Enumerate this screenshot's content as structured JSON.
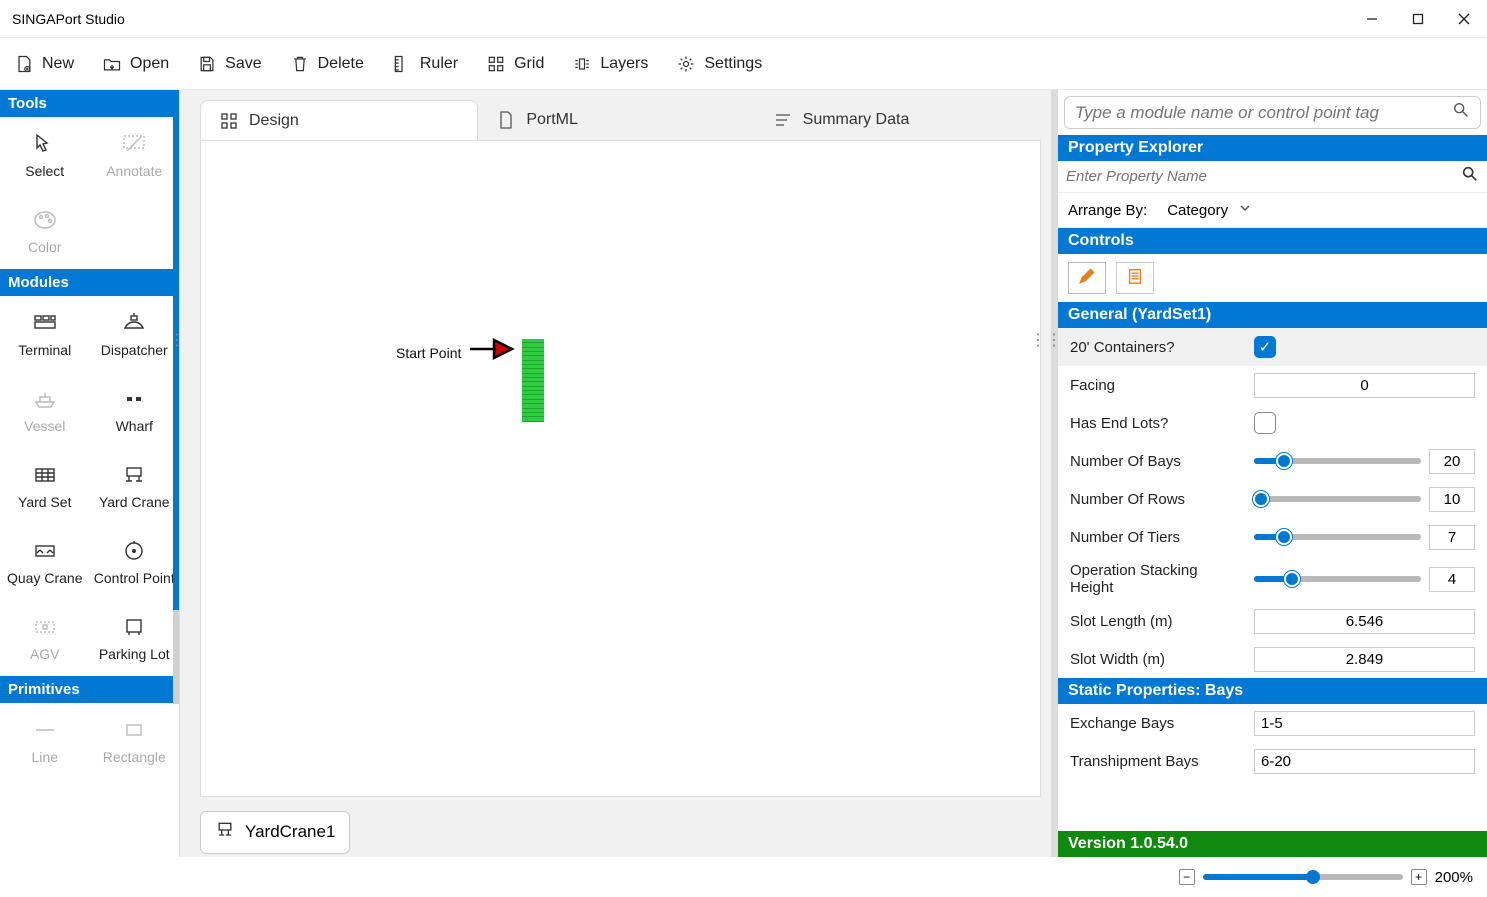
{
  "app": {
    "title": "SINGAPort Studio"
  },
  "toolbar": {
    "new": "New",
    "open": "Open",
    "save": "Save",
    "delete": "Delete",
    "ruler": "Ruler",
    "grid": "Grid",
    "layers": "Layers",
    "settings": "Settings"
  },
  "left": {
    "sections": {
      "tools": "Tools",
      "modules": "Modules",
      "primitives": "Primitives"
    },
    "tools": {
      "select": "Select",
      "annotate": "Annotate",
      "color": "Color"
    },
    "modules": {
      "terminal": "Terminal",
      "dispatcher": "Dispatcher",
      "vessel": "Vessel",
      "wharf": "Wharf",
      "yardset": "Yard Set",
      "yardcrane": "Yard Crane",
      "quaycrane": "Quay Crane",
      "controlpoint": "Control Point",
      "agv": "AGV",
      "parkinglot": "Parking Lot"
    },
    "primitives": {
      "line": "Line",
      "rectangle": "Rectangle"
    }
  },
  "tabs": {
    "design": "Design",
    "portml": "PortML",
    "summary": "Summary Data"
  },
  "canvas": {
    "start_point_label": "Start Point",
    "selected_item": "YardCrane1"
  },
  "right": {
    "search_placeholder": "Type a module name or control point tag",
    "property_explorer": "Property Explorer",
    "prop_search_placeholder": "Enter Property Name",
    "arrange_by_label": "Arrange By:",
    "arrange_by_value": "Category",
    "controls_header": "Controls",
    "general_header": "General (YardSet1)",
    "static_header": "Static Properties: Bays",
    "props": {
      "twenty_ft": {
        "label": "20' Containers?",
        "checked": true
      },
      "facing": {
        "label": "Facing",
        "value": "0"
      },
      "has_end_lots": {
        "label": "Has End Lots?",
        "checked": false
      },
      "num_bays": {
        "label": "Number Of Bays",
        "value": "20",
        "pct": 18
      },
      "num_rows": {
        "label": "Number Of Rows",
        "value": "10",
        "pct": 4
      },
      "num_tiers": {
        "label": "Number Of Tiers",
        "value": "7",
        "pct": 18
      },
      "op_stack": {
        "label": "Operation Stacking Height",
        "value": "4",
        "pct": 23
      },
      "slot_len": {
        "label": "Slot Length (m)",
        "value": "6.546"
      },
      "slot_wid": {
        "label": "Slot Width (m)",
        "value": "2.849"
      },
      "exch_bays": {
        "label": "Exchange Bays",
        "value": "1-5"
      },
      "tranship_bays": {
        "label": "Transhipment Bays",
        "value": "6-20"
      }
    },
    "version": "Version 1.0.54.0"
  },
  "status": {
    "zoom_pct": "200%",
    "zoom_fill_pct": 55
  }
}
